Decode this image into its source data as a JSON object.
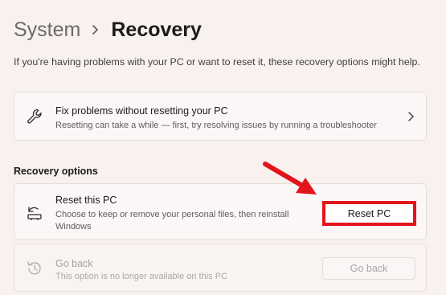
{
  "breadcrumb": {
    "parent": "System",
    "separator_icon": "chevron-right-icon",
    "current": "Recovery"
  },
  "description": "If you're having problems with your PC or want to reset it, these recovery options might help.",
  "fix_problems": {
    "icon": "wrench-icon",
    "title": "Fix problems without resetting your PC",
    "subtitle": "Resetting can take a while — first, try resolving issues by running a troubleshooter",
    "chevron_icon": "chevron-right-icon"
  },
  "recovery_options": {
    "heading": "Recovery options",
    "reset_pc": {
      "icon": "reset-pc-icon",
      "title": "Reset this PC",
      "subtitle": "Choose to keep or remove your personal files, then reinstall Windows",
      "button_label": "Reset PC",
      "highlight_color": "#e3151c"
    },
    "go_back": {
      "icon": "history-icon",
      "title": "Go back",
      "subtitle": "This option is no longer available on this PC",
      "button_label": "Go back",
      "disabled": true
    }
  },
  "annotation": {
    "arrow_color": "#e3151c",
    "points_to": "reset-pc-button"
  }
}
